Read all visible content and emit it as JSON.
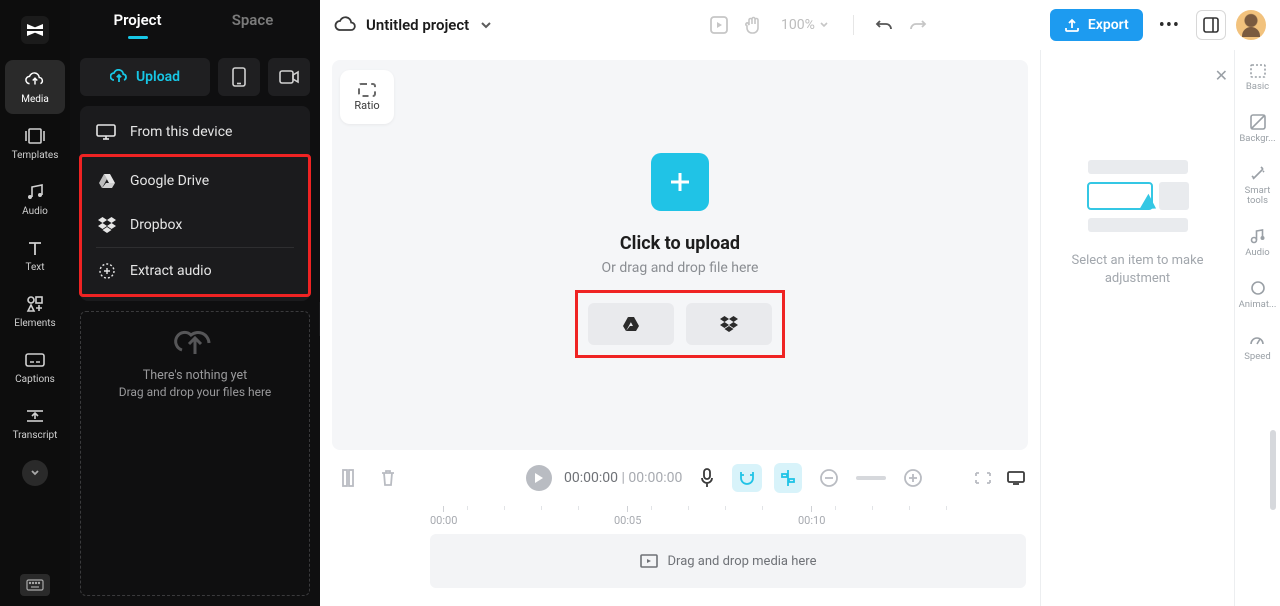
{
  "rail": {
    "items": [
      {
        "label": "Media"
      },
      {
        "label": "Templates"
      },
      {
        "label": "Audio"
      },
      {
        "label": "Text"
      },
      {
        "label": "Elements"
      },
      {
        "label": "Captions"
      },
      {
        "label": "Transcript"
      }
    ]
  },
  "sidepanel": {
    "tabs": {
      "project": "Project",
      "space": "Space"
    },
    "upload_label": "Upload",
    "dropdown": {
      "from_device": "From this device",
      "google_drive": "Google Drive",
      "dropbox": "Dropbox",
      "extract_audio": "Extract audio"
    },
    "empty": {
      "line1": "There's nothing yet",
      "line2": "Drag and drop your files here"
    }
  },
  "topbar": {
    "title": "Untitled project",
    "zoom": "100%",
    "export_label": "Export"
  },
  "canvas": {
    "ratio_label": "Ratio",
    "upload_title": "Click to upload",
    "upload_sub": "Or drag and drop file here"
  },
  "transport": {
    "current": "00:00:00",
    "duration": "00:00:00"
  },
  "timeline": {
    "ticks": [
      "00:00",
      "00:05",
      "00:10"
    ],
    "track_hint": "Drag and drop media here"
  },
  "inspector": {
    "hint": "Select an item to make adjustment"
  },
  "proprail": {
    "items": [
      {
        "label": "Basic"
      },
      {
        "label": "Backgr..."
      },
      {
        "label": "Smart tools"
      },
      {
        "label": "Audio"
      },
      {
        "label": "Animat..."
      },
      {
        "label": "Speed"
      }
    ]
  }
}
